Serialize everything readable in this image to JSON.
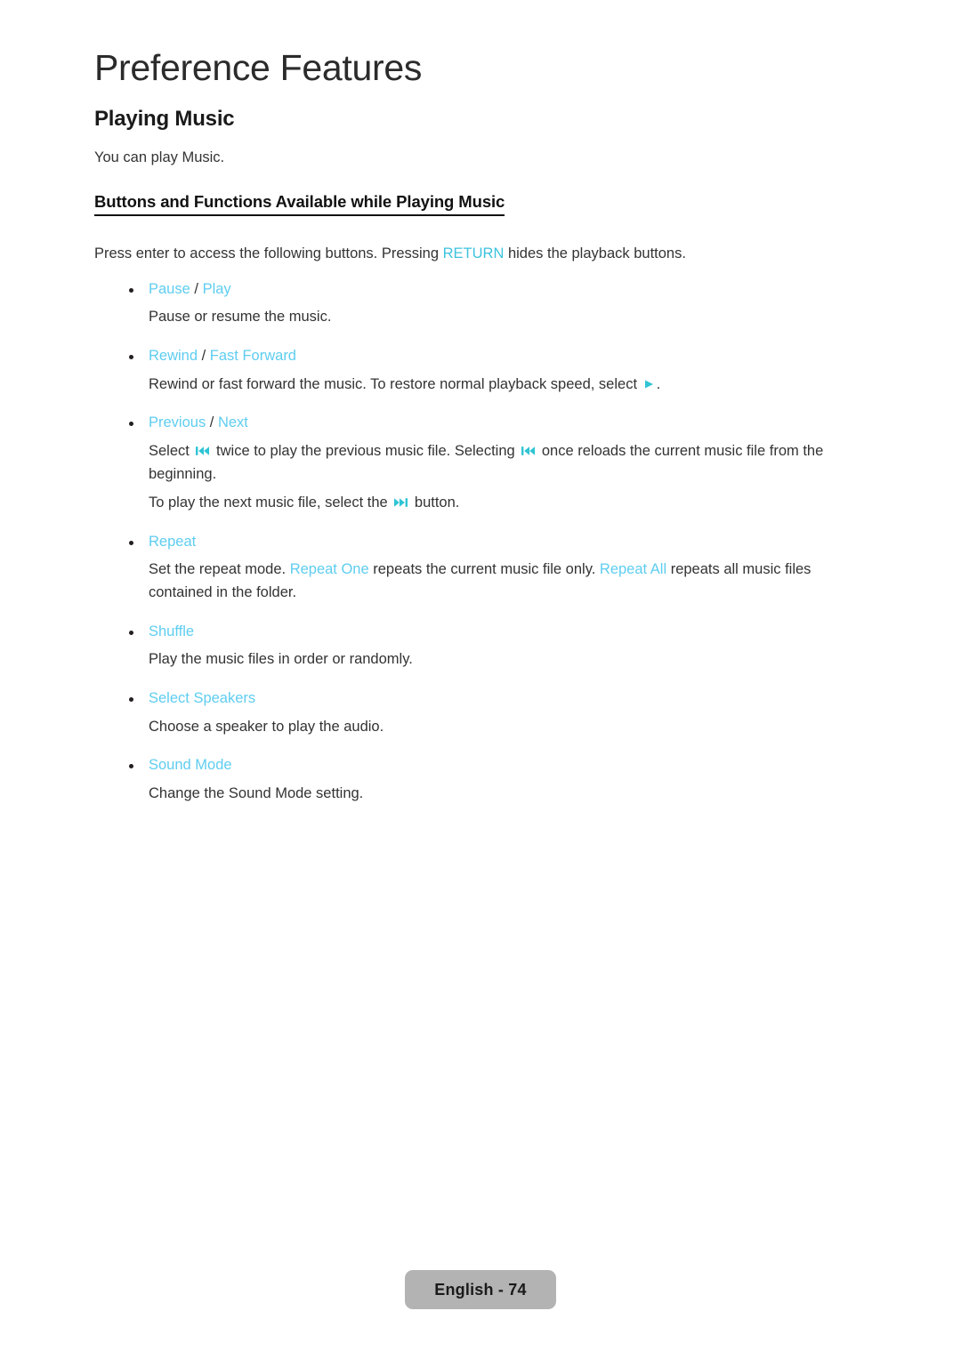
{
  "chapter": {
    "title": "Preference Features"
  },
  "section": {
    "heading": "Playing Music",
    "intro": "You can play Music."
  },
  "subsection": {
    "heading": "Buttons and Functions Available while Playing Music",
    "lead_before": "Press enter to access the following buttons. Pressing ",
    "lead_keyword": "RETURN",
    "lead_after": " hides the playback buttons."
  },
  "buttons": [
    {
      "term_primary": "Pause",
      "separator": " / ",
      "term_secondary": "Play",
      "description": "Pause or resume the music."
    },
    {
      "term_primary": "Rewind",
      "separator": " / ",
      "term_secondary": "Fast Forward",
      "desc_before": "Rewind or fast forward the music. To restore normal playback speed, select ",
      "desc_icon": "play-icon",
      "desc_after": "."
    },
    {
      "term_primary": "Previous",
      "separator": " / ",
      "term_secondary": "Next",
      "desc1_before": "Select ",
      "desc1_icon_a": "skip-back-icon",
      "desc1_mid": " twice to play the previous music file. Selecting ",
      "desc1_icon_b": "skip-back-icon",
      "desc1_after": " once reloads the current music file from the beginning.",
      "desc2_before": "To play the next music file, select the ",
      "desc2_icon": "skip-forward-icon",
      "desc2_after": " button."
    },
    {
      "term_primary": "Repeat",
      "desc_before": "Set the repeat mode. ",
      "desc_keyword_one": "Repeat One",
      "desc_mid": " repeats the current music file only. ",
      "desc_keyword_all": "Repeat All",
      "desc_after": " repeats all music files contained in the folder."
    },
    {
      "term_primary": "Shuffle",
      "description": "Play the music files in order or randomly."
    },
    {
      "term_primary": "Select Speakers",
      "description": "Choose a speaker to play the audio."
    },
    {
      "term_primary": "Sound Mode",
      "description": "Change the Sound Mode setting."
    }
  ],
  "footer": {
    "page_label": "English - 74"
  },
  "colors": {
    "accent": "#5ecdf0",
    "accent_strong": "#3cc3de",
    "icon": "#2ec4d4",
    "text": "#333333",
    "badge_bg": "#b3b3b3"
  }
}
